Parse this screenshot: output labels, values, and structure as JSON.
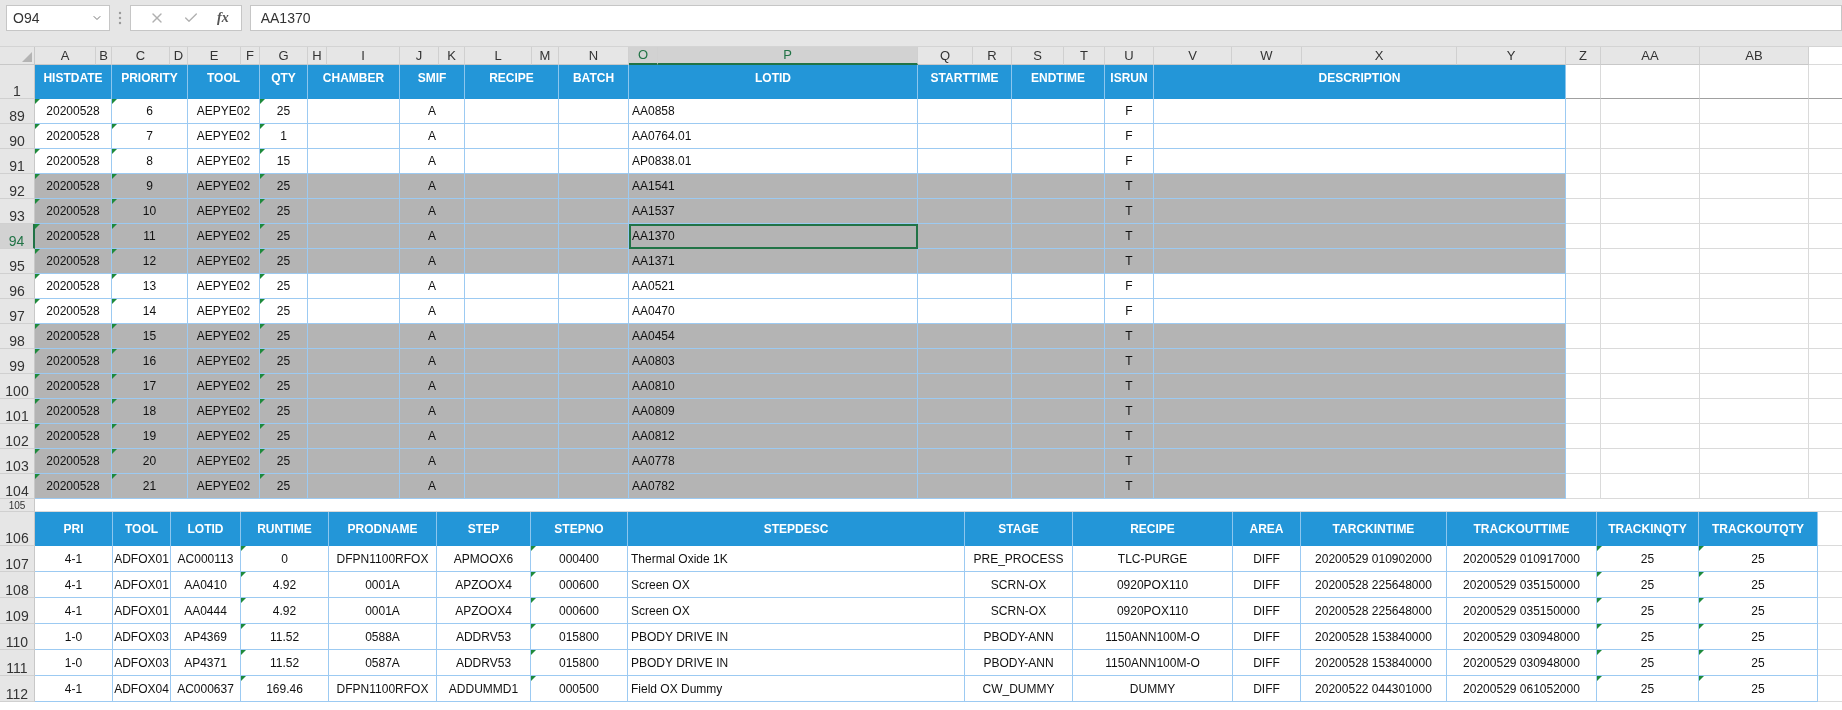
{
  "formula_bar": {
    "name_box": "O94",
    "function_label": "fx",
    "formula": "AA1370"
  },
  "column_letters": [
    {
      "label": "A",
      "selected": false
    },
    {
      "label": "B",
      "selected": false
    },
    {
      "label": "C",
      "selected": false
    },
    {
      "label": "D",
      "selected": false
    },
    {
      "label": "E",
      "selected": false
    },
    {
      "label": "F",
      "selected": false
    },
    {
      "label": "G",
      "selected": false
    },
    {
      "label": "H",
      "selected": false
    },
    {
      "label": "I",
      "selected": false
    },
    {
      "label": "J",
      "selected": false
    },
    {
      "label": "K",
      "selected": false
    },
    {
      "label": "L",
      "selected": false
    },
    {
      "label": "M",
      "selected": false
    },
    {
      "label": "N",
      "selected": false
    },
    {
      "label": "O",
      "selected": true
    },
    {
      "label": "P",
      "selected": true
    },
    {
      "label": "Q",
      "selected": false
    },
    {
      "label": "R",
      "selected": false
    },
    {
      "label": "S",
      "selected": false
    },
    {
      "label": "T",
      "selected": false
    },
    {
      "label": "U",
      "selected": false
    },
    {
      "label": "V",
      "selected": false
    },
    {
      "label": "W",
      "selected": false
    },
    {
      "label": "X",
      "selected": false
    },
    {
      "label": "Y",
      "selected": false
    },
    {
      "label": "Z",
      "selected": false
    },
    {
      "label": "AA",
      "selected": false
    },
    {
      "label": "AB",
      "selected": false
    }
  ],
  "upper_table": {
    "header_row": "1",
    "columns": [
      {
        "label": "HISTDATE",
        "flagged": true
      },
      {
        "label": "PRIORITY",
        "flagged": true
      },
      {
        "label": "TOOL",
        "flagged": false
      },
      {
        "label": "QTY",
        "flagged": true
      },
      {
        "label": "CHAMBER",
        "flagged": false
      },
      {
        "label": "SMIF",
        "flagged": false
      },
      {
        "label": "RECIPE",
        "flagged": false
      },
      {
        "label": "BATCH",
        "flagged": false
      },
      {
        "label": "LOTID",
        "flagged": false
      },
      {
        "label": "STARTTIME",
        "flagged": false
      },
      {
        "label": "ENDTIME",
        "flagged": false
      },
      {
        "label": "ISRUN",
        "flagged": false
      },
      {
        "label": "DESCRIPTION",
        "flagged": false
      }
    ],
    "rows": [
      {
        "number": "89",
        "shaded": false,
        "selected": false,
        "cells": [
          "20200528",
          "6",
          "AEPYE02",
          "25",
          null,
          "A",
          null,
          null,
          "AA0858",
          null,
          null,
          "F",
          null
        ]
      },
      {
        "number": "90",
        "shaded": false,
        "selected": false,
        "cells": [
          "20200528",
          "7",
          "AEPYE02",
          "1",
          null,
          "A",
          null,
          null,
          "AA0764.01",
          null,
          null,
          "F",
          null
        ]
      },
      {
        "number": "91",
        "shaded": false,
        "selected": false,
        "cells": [
          "20200528",
          "8",
          "AEPYE02",
          "15",
          null,
          "A",
          null,
          null,
          "AP0838.01",
          null,
          null,
          "F",
          null
        ]
      },
      {
        "number": "92",
        "shaded": true,
        "selected": false,
        "cells": [
          "20200528",
          "9",
          "AEPYE02",
          "25",
          null,
          "A",
          null,
          null,
          "AA1541",
          null,
          null,
          "T",
          null
        ]
      },
      {
        "number": "93",
        "shaded": true,
        "selected": false,
        "cells": [
          "20200528",
          "10",
          "AEPYE02",
          "25",
          null,
          "A",
          null,
          null,
          "AA1537",
          null,
          null,
          "T",
          null
        ]
      },
      {
        "number": "94",
        "shaded": true,
        "selected": true,
        "cells": [
          "20200528",
          "11",
          "AEPYE02",
          "25",
          null,
          "A",
          null,
          null,
          "AA1370",
          null,
          null,
          "T",
          null
        ]
      },
      {
        "number": "95",
        "shaded": true,
        "selected": false,
        "cells": [
          "20200528",
          "12",
          "AEPYE02",
          "25",
          null,
          "A",
          null,
          null,
          "AA1371",
          null,
          null,
          "T",
          null
        ]
      },
      {
        "number": "96",
        "shaded": false,
        "selected": false,
        "cells": [
          "20200528",
          "13",
          "AEPYE02",
          "25",
          null,
          "A",
          null,
          null,
          "AA0521",
          null,
          null,
          "F",
          null
        ]
      },
      {
        "number": "97",
        "shaded": false,
        "selected": false,
        "cells": [
          "20200528",
          "14",
          "AEPYE02",
          "25",
          null,
          "A",
          null,
          null,
          "AA0470",
          null,
          null,
          "F",
          null
        ]
      },
      {
        "number": "98",
        "shaded": true,
        "selected": false,
        "cells": [
          "20200528",
          "15",
          "AEPYE02",
          "25",
          null,
          "A",
          null,
          null,
          "AA0454",
          null,
          null,
          "T",
          null
        ]
      },
      {
        "number": "99",
        "shaded": true,
        "selected": false,
        "cells": [
          "20200528",
          "16",
          "AEPYE02",
          "25",
          null,
          "A",
          null,
          null,
          "AA0803",
          null,
          null,
          "T",
          null
        ]
      },
      {
        "number": "100",
        "shaded": true,
        "selected": false,
        "cells": [
          "20200528",
          "17",
          "AEPYE02",
          "25",
          null,
          "A",
          null,
          null,
          "AA0810",
          null,
          null,
          "T",
          null
        ]
      },
      {
        "number": "101",
        "shaded": true,
        "selected": false,
        "cells": [
          "20200528",
          "18",
          "AEPYE02",
          "25",
          null,
          "A",
          null,
          null,
          "AA0809",
          null,
          null,
          "T",
          null
        ]
      },
      {
        "number": "102",
        "shaded": true,
        "selected": false,
        "cells": [
          "20200528",
          "19",
          "AEPYE02",
          "25",
          null,
          "A",
          null,
          null,
          "AA0812",
          null,
          null,
          "T",
          null
        ]
      },
      {
        "number": "103",
        "shaded": true,
        "selected": false,
        "cells": [
          "20200528",
          "20",
          "AEPYE02",
          "25",
          null,
          "A",
          null,
          null,
          "AA0778",
          null,
          null,
          "T",
          null
        ]
      },
      {
        "number": "104",
        "shaded": true,
        "selected": false,
        "cells": [
          "20200528",
          "21",
          "AEPYE02",
          "25",
          null,
          "A",
          null,
          null,
          "AA0782",
          null,
          null,
          "T",
          null
        ]
      }
    ]
  },
  "spacer_row": "105",
  "lower_table": {
    "header_row": "106",
    "columns": [
      {
        "label": "PRI",
        "flagged": false
      },
      {
        "label": "TOOL",
        "flagged": false
      },
      {
        "label": "LOTID",
        "flagged": false
      },
      {
        "label": "RUNTIME",
        "flagged": true
      },
      {
        "label": "PRODNAME",
        "flagged": false
      },
      {
        "label": "STEP",
        "flagged": false
      },
      {
        "label": "STEPNO",
        "flagged": true
      },
      {
        "label": "STEPDESC",
        "flagged": false
      },
      {
        "label": "STAGE",
        "flagged": false
      },
      {
        "label": "RECIPE",
        "flagged": false
      },
      {
        "label": "AREA",
        "flagged": false
      },
      {
        "label": "TARCKINTIME",
        "flagged": false
      },
      {
        "label": "TRACKOUTTIME",
        "flagged": false
      },
      {
        "label": "TRACKINQTY",
        "flagged": true
      },
      {
        "label": "TRACKOUTQTY",
        "flagged": true
      }
    ],
    "rows": [
      {
        "number": "107",
        "cells": [
          "4-1",
          "ADFOX01",
          "AC000113",
          "0",
          "DFPN1100RFOX",
          "APMOOX6",
          "000400",
          "Thermal Oxide 1K",
          "PRE_PROCESS",
          "TLC-PURGE",
          "DIFF",
          "20200529 010902000",
          "20200529 010917000",
          "25",
          "25"
        ]
      },
      {
        "number": "108",
        "cells": [
          "4-1",
          "ADFOX01",
          "AA0410",
          "4.92",
          "0001A",
          "APZOOX4",
          "000600",
          "Screen OX",
          "SCRN-OX",
          "0920POX110",
          "DIFF",
          "20200528 225648000",
          "20200529 035150000",
          "25",
          "25"
        ]
      },
      {
        "number": "109",
        "cells": [
          "4-1",
          "ADFOX01",
          "AA0444",
          "4.92",
          "0001A",
          "APZOOX4",
          "000600",
          "Screen OX",
          "SCRN-OX",
          "0920POX110",
          "DIFF",
          "20200528 225648000",
          "20200529 035150000",
          "25",
          "25"
        ]
      },
      {
        "number": "110",
        "cells": [
          "1-0",
          "ADFOX03",
          "AP4369",
          "11.52",
          "0588A",
          "ADDRV53",
          "015800",
          "PBODY DRIVE IN",
          "PBODY-ANN",
          "1150ANN100M-O",
          "DIFF",
          "20200528 153840000",
          "20200529 030948000",
          "25",
          "25"
        ]
      },
      {
        "number": "111",
        "cells": [
          "1-0",
          "ADFOX03",
          "AP4371",
          "11.52",
          "0587A",
          "ADDRV53",
          "015800",
          "PBODY DRIVE IN",
          "PBODY-ANN",
          "1150ANN100M-O",
          "DIFF",
          "20200528 153840000",
          "20200529 030948000",
          "25",
          "25"
        ]
      },
      {
        "number": "112",
        "cells": [
          "4-1",
          "ADFOX04",
          "AC000637",
          "169.46",
          "DFPN1100RFOX",
          "ADDUMMD1",
          "000500",
          "Field OX Dummy",
          "CW_DUMMY",
          "DUMMY",
          "DIFF",
          "20200522 044301000",
          "20200529 061052000",
          "25",
          "25"
        ]
      }
    ]
  }
}
